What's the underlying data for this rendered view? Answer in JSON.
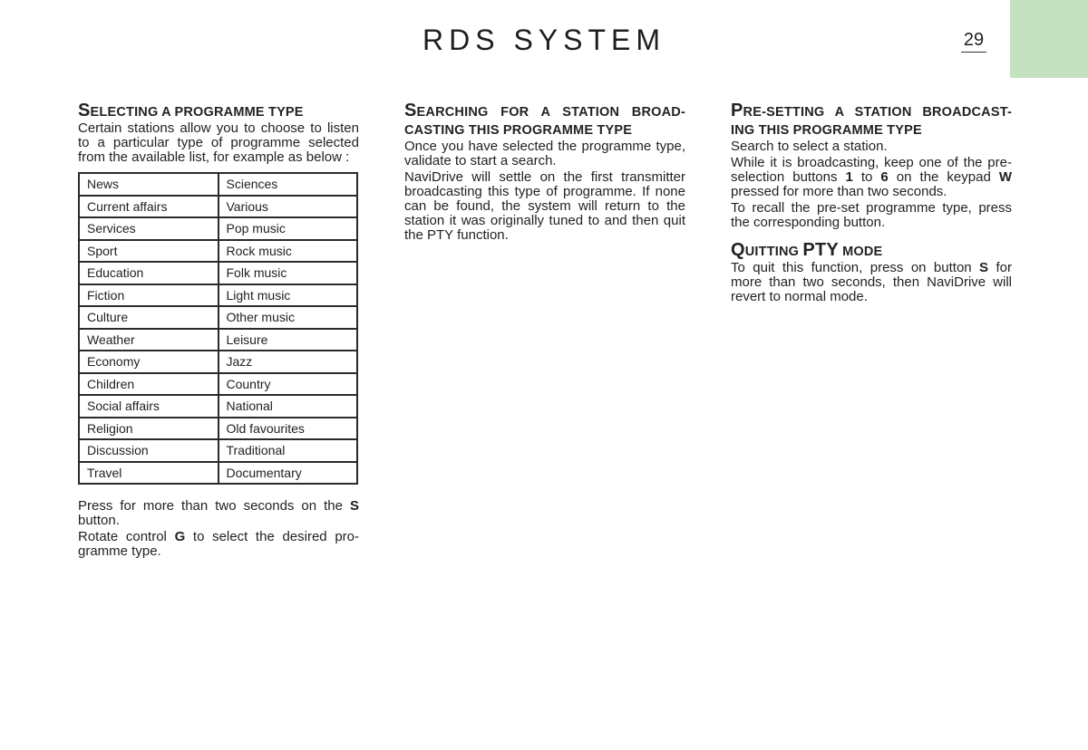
{
  "header": {
    "title": "RDS SYSTEM",
    "page_number": "29",
    "tab_color": "#c4e2bf"
  },
  "sections": {
    "selecting": {
      "heading_first": "S",
      "heading_rest": "electing a programme type",
      "intro": "Certain stations allow you to choose to listen to a particular type of programme selected from the available list, for example as below :",
      "table": [
        [
          "News",
          "Sciences"
        ],
        [
          "Current affairs",
          "Various"
        ],
        [
          "Services",
          "Pop music"
        ],
        [
          "Sport",
          "Rock music"
        ],
        [
          "Education",
          "Folk music"
        ],
        [
          "Fiction",
          "Light music"
        ],
        [
          "Culture",
          "Other music"
        ],
        [
          "Weather",
          "Leisure"
        ],
        [
          "Economy",
          "Jazz"
        ],
        [
          "Children",
          "Country"
        ],
        [
          "Social affairs",
          "National"
        ],
        [
          "Religion",
          "Old favourites"
        ],
        [
          "Discussion",
          "Traditional"
        ],
        [
          "Travel",
          "Documentary"
        ]
      ],
      "p1_before": "Press for more than two seconds on the ",
      "p1_bold": "S",
      "p1_after": " button.",
      "p2_before": "Rotate control ",
      "p2_bold": "G",
      "p2_after": " to select the desired pro-gramme type."
    },
    "searching": {
      "heading_first": "S",
      "heading_rest": "earching for a station broad-casting this programme type",
      "p1": "Once you have selected the programme type, validate to start a search.",
      "p2": "NaviDrive will settle on the first transmitter broadcasting this type of programme. If none can be found, the system will return to the station it was originally tuned to and then quit the PTY function."
    },
    "presetting": {
      "heading_first": "P",
      "heading_rest": "re-setting a station broadcast-ing this programme type",
      "p1": "Search to select a station.",
      "p2_a": "While it is broadcasting, keep one of the pre-selection buttons ",
      "p2_b1": "1",
      "p2_c": " to ",
      "p2_b2": "6",
      "p2_d": " on the keypad ",
      "p2_b3": "W",
      "p2_e": " pressed for more than two seconds.",
      "p3": "To recall the pre-set programme type, press the corresponding button."
    },
    "quitting": {
      "heading_first": "Q",
      "heading_mid": "uitting ",
      "heading_pty": "PTY",
      "heading_end": " mode",
      "p1_before": "To quit this function, press on button ",
      "p1_bold": "S",
      "p1_after": " for more than two seconds, then NaviDrive will revert to normal mode."
    }
  }
}
